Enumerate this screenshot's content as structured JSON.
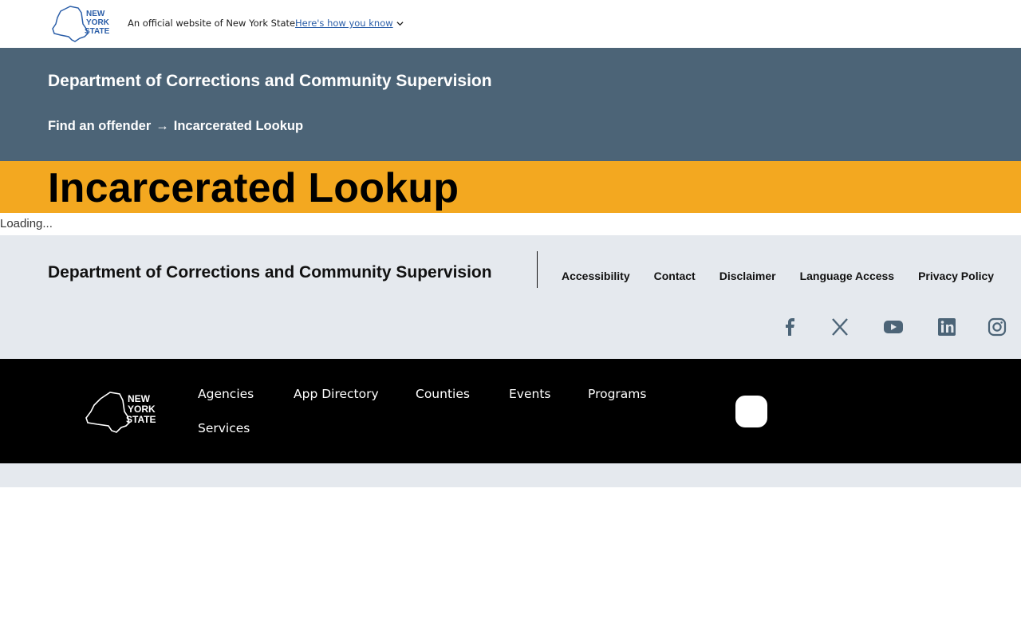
{
  "gov_bar": {
    "logo_text": "NEW YORK STATE",
    "official_text": "An official website of New York State.",
    "how_link": "Here's how you know"
  },
  "agency": {
    "name": "Department of Corrections and Community Supervision",
    "breadcrumb": {
      "parent": "Find an offender",
      "separator": "→",
      "current": "Incarcerated Lookup"
    }
  },
  "page": {
    "title": "Incarcerated Lookup",
    "loading": "Loading..."
  },
  "agency_footer": {
    "name": "Department of Corrections and Community Supervision",
    "links": [
      "Accessibility",
      "Contact",
      "Disclaimer",
      "Language Access",
      "Privacy Policy"
    ],
    "social": [
      "facebook-icon",
      "x-icon",
      "youtube-icon",
      "linkedin-icon",
      "instagram-icon"
    ]
  },
  "global_footer": {
    "logo_text": "NEW YORK STATE",
    "links": [
      "Agencies",
      "App Directory",
      "Counties",
      "Events",
      "Programs",
      "Services"
    ]
  },
  "colors": {
    "agency_header": "#4c6477",
    "title_band": "#f3a820",
    "footer_light": "#e5e9ee",
    "footer_dark": "#000000",
    "logo_blue": "#2b5ea8"
  }
}
